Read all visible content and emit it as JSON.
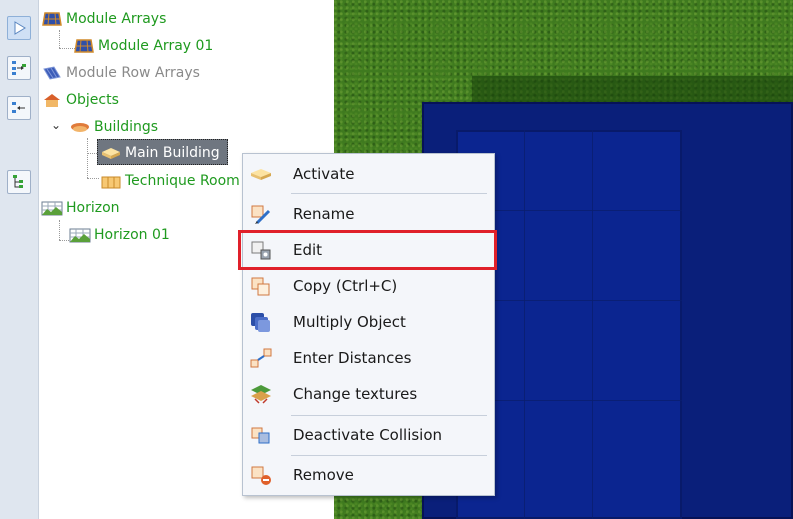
{
  "tree": {
    "nodes": [
      {
        "label": "Module Arrays"
      },
      {
        "label": "Module Array 01"
      },
      {
        "label": "Module Row Arrays"
      },
      {
        "label": "Objects"
      },
      {
        "label": "Buildings"
      },
      {
        "label": "Main Building"
      },
      {
        "label": "Technique Room"
      },
      {
        "label": "Horizon"
      },
      {
        "label": "Horizon 01"
      }
    ],
    "selected": "Main Building",
    "expanded_glyph": "⌄"
  },
  "context_menu": {
    "items": [
      {
        "label": "Activate",
        "icon": "activate-icon"
      },
      {
        "label": "Rename",
        "icon": "rename-icon"
      },
      {
        "label": "Edit",
        "icon": "edit-icon"
      },
      {
        "label": "Copy (Ctrl+C)",
        "icon": "copy-icon"
      },
      {
        "label": "Multiply Object",
        "icon": "multiply-icon"
      },
      {
        "label": "Enter Distances",
        "icon": "distances-icon"
      },
      {
        "label": "Change textures",
        "icon": "textures-icon"
      },
      {
        "label": "Deactivate Collision",
        "icon": "collision-icon"
      },
      {
        "label": "Remove",
        "icon": "remove-icon"
      }
    ],
    "highlighted": "Edit",
    "highlight_color": "#e0202a"
  },
  "colors": {
    "tree_text": "#1f9a1f",
    "tree_text_disabled": "#8a8a8a",
    "grass": "#3f7a1f",
    "building": "#0a1f7a"
  }
}
